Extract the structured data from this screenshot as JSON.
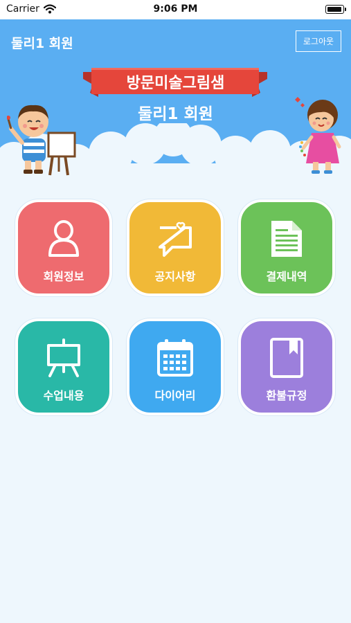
{
  "status_bar": {
    "carrier": "Carrier",
    "time": "9:06 PM"
  },
  "header": {
    "title": "둘리1 회원",
    "logout_label": "로그아웃",
    "banner_title": "방문미술그림샘",
    "banner_subtitle": "둘리1 회원"
  },
  "menu": [
    {
      "label": "회원정보",
      "icon": "person-icon",
      "color": "#ee6b6f"
    },
    {
      "label": "공지사항",
      "icon": "speech-bubble-heart-icon",
      "color": "#f1b937"
    },
    {
      "label": "결제내역",
      "icon": "document-icon",
      "color": "#6cc259"
    },
    {
      "label": "수업내용",
      "icon": "easel-icon",
      "color": "#29b8a7"
    },
    {
      "label": "다이어리",
      "icon": "calendar-icon",
      "color": "#3fa9f0"
    },
    {
      "label": "환불규정",
      "icon": "book-icon",
      "color": "#9c7fdc"
    }
  ],
  "colors": {
    "header_bg": "#5aaef2",
    "page_bg": "#eef7fd",
    "ribbon": "#e5463b"
  }
}
